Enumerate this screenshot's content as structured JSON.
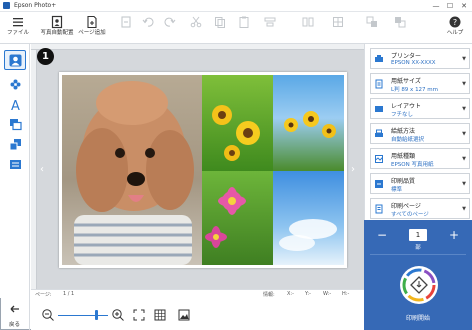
{
  "window": {
    "title": "Epson Photo+",
    "controls": [
      "—",
      "☐",
      "✕"
    ]
  },
  "toolbar": {
    "file_label": "ファイル",
    "photo_auto_arrange_label": "写真自動配置",
    "add_page_label": "ページ追加",
    "help_label": "ヘルプ"
  },
  "callout": {
    "number": "1"
  },
  "status": {
    "page_label": "ページ:",
    "page_value": "1 / 1",
    "info_label": "情報:",
    "x_label": "X:-",
    "y_label": "Y:-",
    "w_label": "W:-",
    "h_label": "H:-"
  },
  "back": {
    "label": "戻る"
  },
  "zoom": {
    "level": 0.15
  },
  "settings": [
    {
      "title": "プリンター",
      "value": "EPSON XX-XXXX",
      "icon": "printer-icon"
    },
    {
      "title": "用紙サイズ",
      "value": "L判 89 x 127 mm",
      "icon": "paper-size-icon"
    },
    {
      "title": "レイアウト",
      "value": "フチなし",
      "icon": "layout-icon"
    },
    {
      "title": "給紙方法",
      "value": "自動給紙選択",
      "icon": "paper-source-icon"
    },
    {
      "title": "用紙種類",
      "value": "EPSON 写真用紙",
      "icon": "paper-type-icon"
    },
    {
      "title": "印刷品質",
      "value": "標準",
      "icon": "print-quality-icon"
    },
    {
      "title": "印刷ページ",
      "value": "すべてのページ",
      "icon": "print-page-icon"
    }
  ],
  "copies": {
    "value": "1",
    "unit": "部",
    "minus": "−",
    "plus": "+"
  },
  "print": {
    "label": "印刷開始"
  },
  "colors": {
    "accent": "#2b78d0",
    "panel_blue": "#3669b6"
  }
}
